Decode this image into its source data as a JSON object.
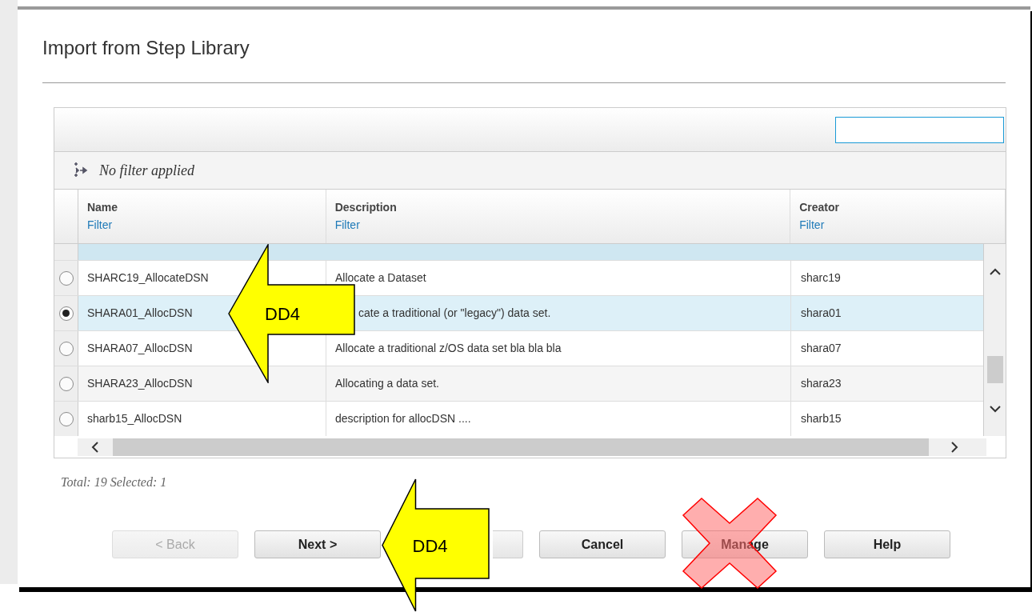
{
  "dialog": {
    "title": "Import from Step Library"
  },
  "filter_bar": {
    "text": "No filter applied"
  },
  "table": {
    "columns": [
      {
        "label": "Name",
        "filter": "Filter"
      },
      {
        "label": "Description",
        "filter": "Filter"
      },
      {
        "label": "Creator",
        "filter": "Filter"
      }
    ],
    "rows": [
      {
        "name": "SHARC19_AllocateDSN",
        "description": "Allocate a Dataset",
        "creator": "sharc19",
        "selected": false,
        "covered": false
      },
      {
        "name": "SHARA01_AllocDSN",
        "description": "cate a traditional (or \"legacy\") data set.",
        "creator": "shara01",
        "selected": true,
        "covered": true
      },
      {
        "name": "SHARA07_AllocDSN",
        "description": "Allocate a traditional z/OS data set bla bla bla",
        "creator": "shara07",
        "selected": false,
        "covered": false
      },
      {
        "name": "SHARA23_AllocDSN",
        "description": "Allocating a data set.",
        "creator": "shara23",
        "selected": false,
        "covered": false
      },
      {
        "name": "sharb15_AllocDSN",
        "description": "description for allocDSN ....",
        "creator": "sharb15",
        "selected": false,
        "covered": false
      }
    ]
  },
  "summary": "Total: 19 Selected: 1",
  "buttons": [
    {
      "label": "< Back",
      "disabled": true
    },
    {
      "label": "Next >",
      "disabled": false
    },
    {
      "disabled": false
    },
    {
      "label": "Cancel",
      "disabled": false
    },
    {
      "label": "Manage",
      "disabled": false
    },
    {
      "label": "Help",
      "disabled": false
    }
  ],
  "annotations": [
    {
      "kind": "arrow",
      "label": "DD4"
    },
    {
      "kind": "arrow",
      "label": "DD4"
    },
    {
      "kind": "cross"
    }
  ]
}
